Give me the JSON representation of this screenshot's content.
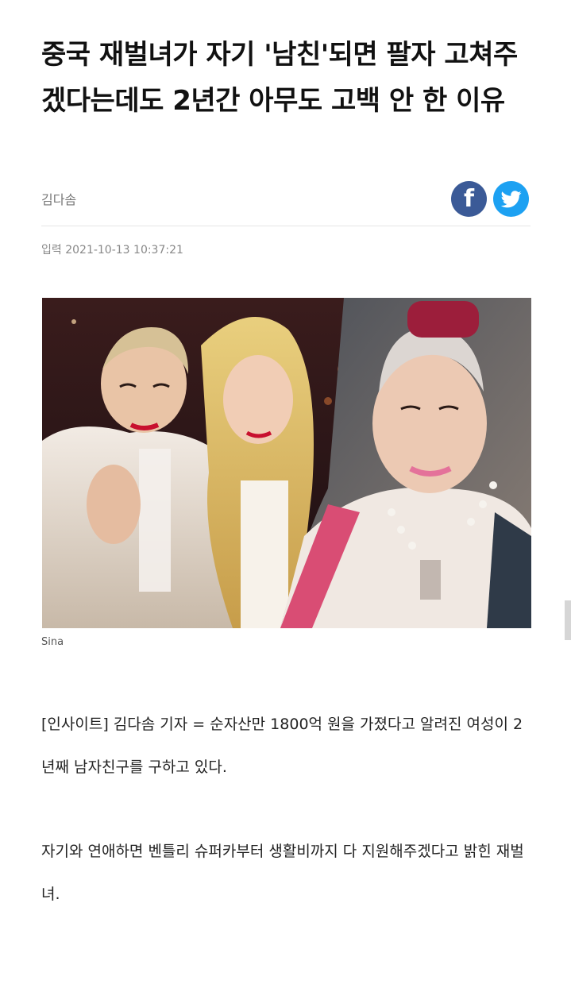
{
  "article": {
    "headline": "중국 재벌녀가 자기 '남친'되면 팔자 고쳐주겠다는데도 2년간 아무도 고백 안 한 이유",
    "author": "김다솜",
    "published_label": "입력",
    "published_time": "2021-10-13 10:37:21",
    "photo_caption": "Sina",
    "paragraphs": [
      "[인사이트] 김다솜 기자 = 순자산만 1800억 원을 가졌다고 알려진 여성이 2년째 남자친구를 구하고 있다.",
      "자기와 연애하면 벤틀리 슈퍼카부터 생활비까지 다 지원해주겠다고 밝힌 재벌녀."
    ]
  },
  "share": {
    "facebook_glyph": "f",
    "facebook_icon": "facebook-icon",
    "twitter_icon": "twitter-bird-icon",
    "facebook_color": "#3b5a97",
    "twitter_color": "#1da1f2"
  }
}
